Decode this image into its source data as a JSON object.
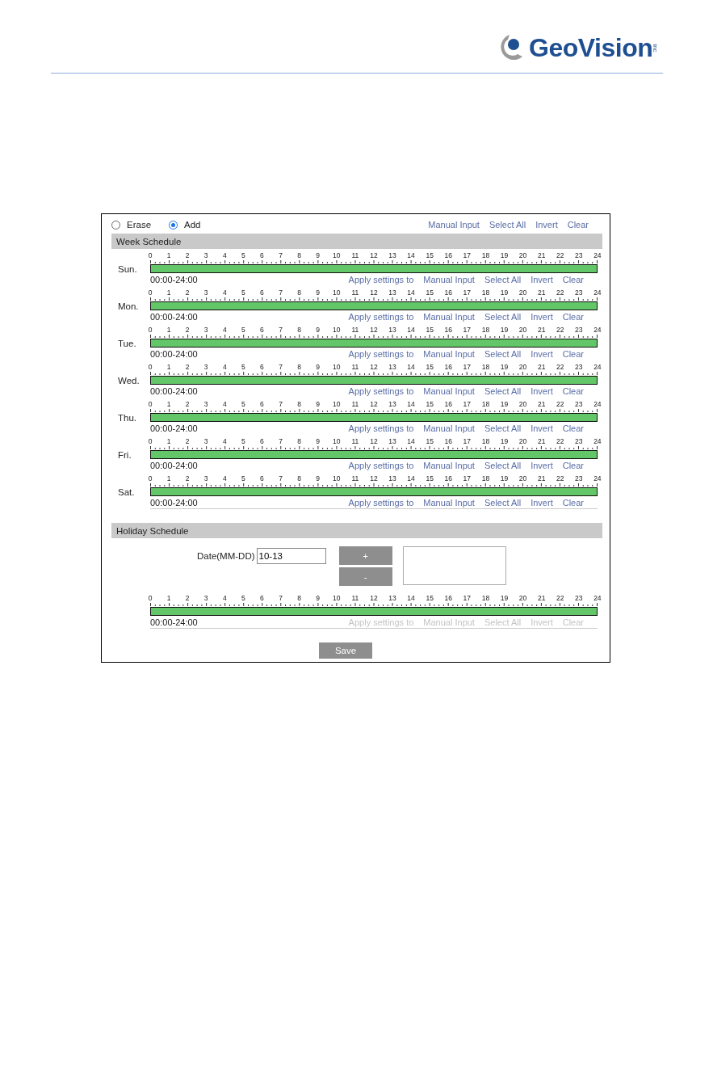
{
  "brand": {
    "name": "GeoVision",
    "suffix": "inc"
  },
  "mode": [
    {
      "label": "Erase",
      "selected": false
    },
    {
      "label": "Add",
      "selected": true
    }
  ],
  "top_links": [
    "Manual Input",
    "Select All",
    "Invert",
    "Clear"
  ],
  "week_schedule": {
    "title": "Week Schedule",
    "days": [
      {
        "label": "Sun.",
        "hours": [
          "0",
          "1",
          "2",
          "3",
          "4",
          "5",
          "6",
          "7",
          "8",
          "9",
          "10",
          "11",
          "12",
          "13",
          "14",
          "15",
          "16",
          "17",
          "18",
          "19",
          "20",
          "21",
          "22",
          "23",
          "24"
        ],
        "level": 1,
        "range": "00:00-24:00",
        "links": [
          "Apply settings to",
          "Manual Input",
          "Select All",
          "Invert",
          "Clear"
        ]
      },
      {
        "label": "Mon.",
        "hours": [
          "0",
          "1",
          "2",
          "3",
          "4",
          "5",
          "6",
          "7",
          "8",
          "9",
          "10",
          "11",
          "12",
          "13",
          "14",
          "15",
          "16",
          "17",
          "18",
          "19",
          "20",
          "21",
          "22",
          "23",
          "24"
        ],
        "level": 1,
        "range": "00:00-24:00",
        "links": [
          "Apply settings to",
          "Manual Input",
          "Select All",
          "Invert",
          "Clear"
        ]
      },
      {
        "label": "Tue.",
        "hours": [
          "0",
          "1",
          "2",
          "3",
          "4",
          "5",
          "6",
          "7",
          "8",
          "9",
          "10",
          "11",
          "12",
          "13",
          "14",
          "15",
          "16",
          "17",
          "18",
          "19",
          "20",
          "21",
          "22",
          "23",
          "24"
        ],
        "level": 1,
        "range": "00:00-24:00",
        "links": [
          "Apply settings to",
          "Manual Input",
          "Select All",
          "Invert",
          "Clear"
        ]
      },
      {
        "label": "Wed.",
        "hours": [
          "0",
          "1",
          "2",
          "3",
          "4",
          "5",
          "6",
          "7",
          "8",
          "9",
          "10",
          "11",
          "12",
          "13",
          "14",
          "15",
          "16",
          "17",
          "18",
          "19",
          "20",
          "21",
          "22",
          "23",
          "24"
        ],
        "level": 1,
        "range": "00:00-24:00",
        "links": [
          "Apply settings to",
          "Manual Input",
          "Select All",
          "Invert",
          "Clear"
        ]
      },
      {
        "label": "Thu.",
        "hours": [
          "0",
          "1",
          "2",
          "3",
          "4",
          "5",
          "6",
          "7",
          "8",
          "9",
          "10",
          "11",
          "12",
          "13",
          "14",
          "15",
          "16",
          "17",
          "18",
          "19",
          "20",
          "21",
          "22",
          "23",
          "24"
        ],
        "level": 1,
        "range": "00:00-24:00",
        "links": [
          "Apply settings to",
          "Manual Input",
          "Select All",
          "Invert",
          "Clear"
        ]
      },
      {
        "label": "Fri.",
        "hours": [
          "0",
          "1",
          "2",
          "3",
          "4",
          "5",
          "6",
          "7",
          "8",
          "9",
          "10",
          "11",
          "12",
          "13",
          "14",
          "15",
          "16",
          "17",
          "18",
          "19",
          "20",
          "21",
          "22",
          "23",
          "24"
        ],
        "level": 1,
        "range": "00:00-24:00",
        "links": [
          "Apply settings to",
          "Manual Input",
          "Select All",
          "Invert",
          "Clear"
        ]
      },
      {
        "label": "Sat.",
        "hours": [
          "0",
          "1",
          "2",
          "3",
          "4",
          "5",
          "6",
          "7",
          "8",
          "9",
          "10",
          "11",
          "12",
          "13",
          "14",
          "15",
          "16",
          "17",
          "18",
          "19",
          "20",
          "21",
          "22",
          "23",
          "24"
        ],
        "level": 1,
        "range": "00:00-24:00",
        "links": [
          "Apply settings to",
          "Manual Input",
          "Select All",
          "Invert",
          "Clear"
        ]
      }
    ]
  },
  "holiday_schedule": {
    "title": "Holiday Schedule",
    "date_label": "Date(MM-DD)",
    "date_value": "10-13",
    "add_button": "+",
    "remove_button": "-",
    "timeline": {
      "hours": [
        "0",
        "1",
        "2",
        "3",
        "4",
        "5",
        "6",
        "7",
        "8",
        "9",
        "10",
        "11",
        "12",
        "13",
        "14",
        "15",
        "16",
        "17",
        "18",
        "19",
        "20",
        "21",
        "22",
        "23",
        "24"
      ],
      "level": 1,
      "range": "00:00-24:00",
      "links": [
        "Apply settings to",
        "Manual Input",
        "Select All",
        "Invert",
        "Clear"
      ],
      "disabled": true
    }
  },
  "save_button": "Save"
}
